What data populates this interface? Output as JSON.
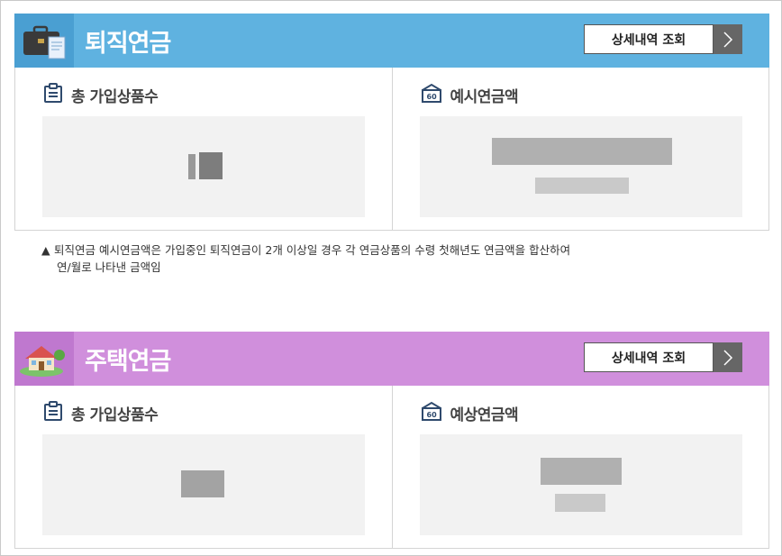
{
  "retirement": {
    "title": "퇴직연금",
    "detail_button": "상세내역 조회",
    "panel_left_title": "총 가입상품수",
    "panel_right_title": "예시연금액",
    "note_line1": "퇴직연금 예시연금액은 가입중인 퇴직연금이 2개 이상일 경우 각 연금상품의 수령 첫해년도 연금액을 합산하여",
    "note_line2": "연/월로 나타낸 금액임",
    "note_marker": "▲"
  },
  "housing": {
    "title": "주택연금",
    "detail_button": "상세내역 조회",
    "panel_left_title": "총 가입상품수",
    "panel_right_title": "예상연금액"
  },
  "colors": {
    "retirement_header": "#5fb2e0",
    "housing_header": "#d08fdc"
  },
  "icons": {
    "retirement_header_icon": "briefcase-icon",
    "housing_header_icon": "house-icon",
    "count_icon": "list-clipboard-icon",
    "amount_icon": "calendar-60-icon",
    "button_arrow_icon": "chevron-right-icon"
  }
}
